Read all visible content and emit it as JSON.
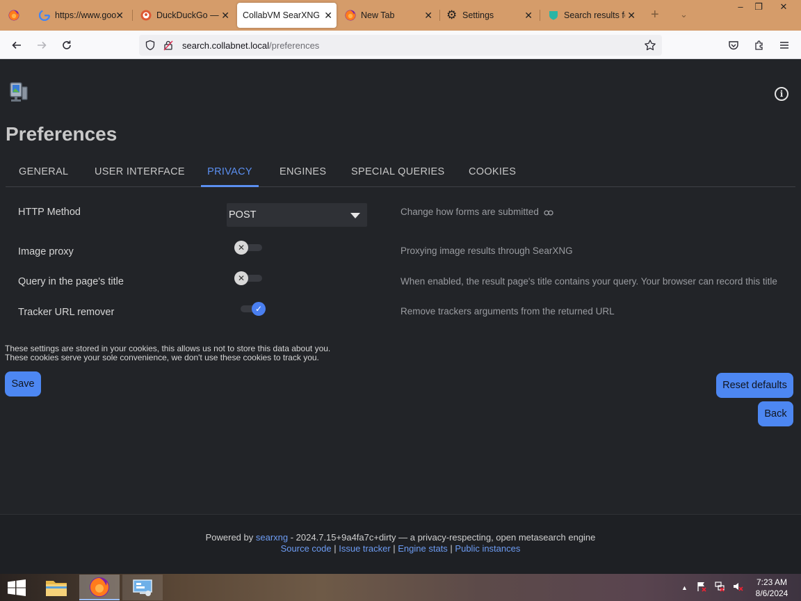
{
  "browser": {
    "tabs": [
      {
        "title": "https://www.goo",
        "icon": "google-icon"
      },
      {
        "title": "DuckDuckGo — ",
        "icon": "duckduckgo-icon"
      },
      {
        "title": "CollabVM SearXNG",
        "icon": "none",
        "active": true
      },
      {
        "title": "New Tab",
        "icon": "firefox-icon"
      },
      {
        "title": "Settings",
        "icon": "gear-icon"
      },
      {
        "title": "Search results fo",
        "icon": "searxng-icon"
      }
    ],
    "url_host": "search.collabnet.local",
    "url_path": "/preferences"
  },
  "page": {
    "title": "Preferences",
    "tabs": [
      "GENERAL",
      "USER INTERFACE",
      "PRIVACY",
      "ENGINES",
      "SPECIAL QUERIES",
      "COOKIES"
    ],
    "active_tab": "PRIVACY",
    "settings": [
      {
        "label": "HTTP Method",
        "control": "select",
        "value": "POST",
        "description": "Change how forms are submitted"
      },
      {
        "label": "Image proxy",
        "control": "toggle",
        "enabled": false,
        "description": "Proxying image results through SearXNG"
      },
      {
        "label": "Query in the page's title",
        "control": "toggle",
        "enabled": false,
        "description": "When enabled, the result page's title contains your query. Your browser can record this title"
      },
      {
        "label": "Tracker URL remover",
        "control": "toggle",
        "enabled": true,
        "description": "Remove trackers arguments from the returned URL"
      }
    ],
    "note_line1": "These settings are stored in your cookies, this allows us not to store this data about you.",
    "note_line2": "These cookies serve your sole convenience, we don't use these cookies to track you.",
    "save_label": "Save",
    "reset_label": "Reset defaults",
    "back_label": "Back",
    "accent_color": "#4d87f2"
  },
  "footer": {
    "powered_by": "Powered by",
    "engine_link": "searxng",
    "version_text": " - 2024.7.15+9a4fa7c+dirty — a privacy-respecting, open metasearch engine",
    "links": [
      "Source code",
      "Issue tracker",
      "Engine stats",
      "Public instances"
    ],
    "separator": " | "
  },
  "taskbar": {
    "time": "7:23 AM",
    "date": "8/6/2024"
  }
}
